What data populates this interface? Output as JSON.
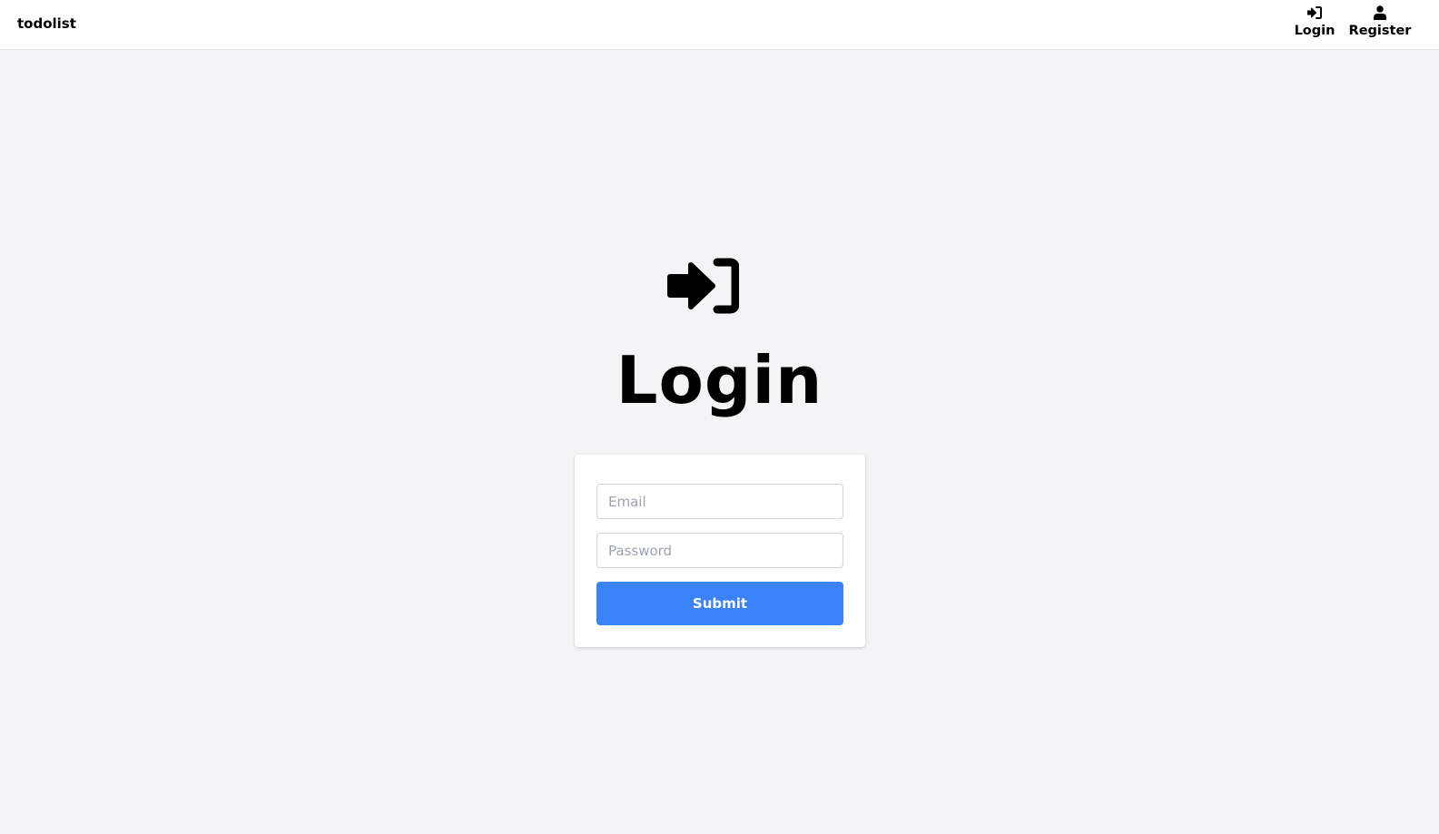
{
  "navbar": {
    "brand": "todolist",
    "items": [
      {
        "label": "Login",
        "icon": "sign-in-icon"
      },
      {
        "label": "Register",
        "icon": "user-icon"
      }
    ]
  },
  "main": {
    "icon": "sign-in-icon",
    "title": "Login",
    "form": {
      "email_placeholder": "Email",
      "email_value": "",
      "password_placeholder": "Password",
      "password_value": "",
      "submit_label": "Submit"
    }
  },
  "colors": {
    "background": "#f3f4f6",
    "navbar": "#ffffff",
    "primary_button": "#3b82f6"
  }
}
